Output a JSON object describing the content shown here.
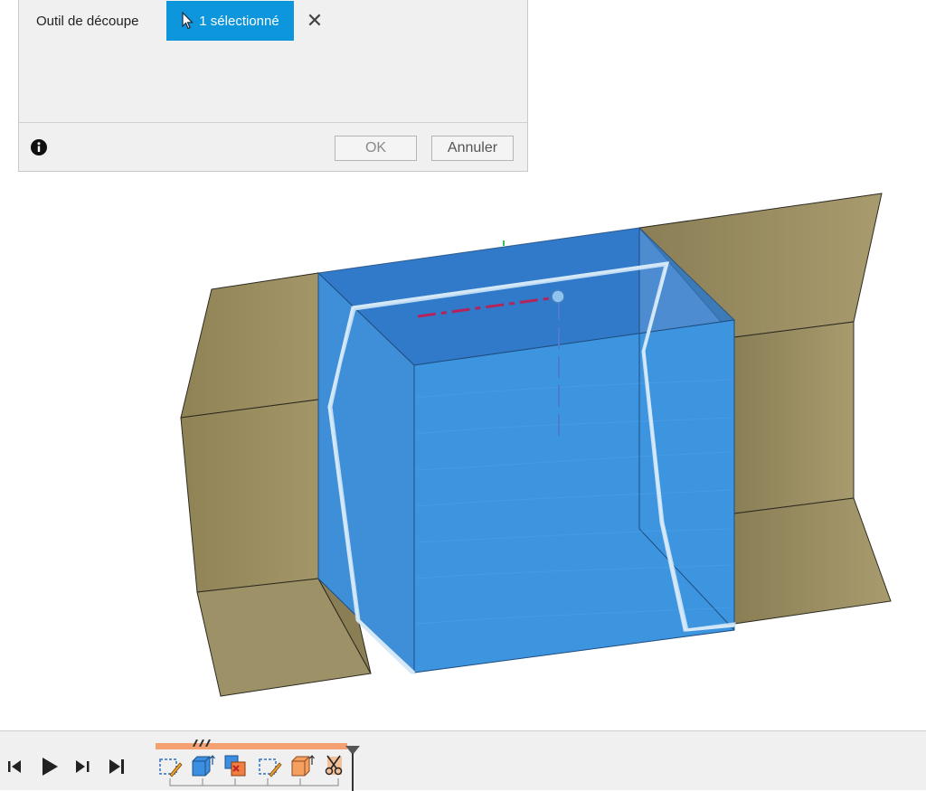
{
  "dialog": {
    "row_label": "Outil de découpe",
    "selection_label": "1 sélectionné",
    "close_symbol": "✕",
    "ok_label": "OK",
    "cancel_label": "Annuler",
    "info_icon": "info-icon",
    "cursor_icon": "cursor-arrow-icon"
  },
  "colors": {
    "accent": "#0d96dc",
    "box_blue": "#3a8fd6",
    "sheet_tan": "#a09468",
    "timeline_track": "#f4a070"
  },
  "timeline": {
    "controls": [
      "step-back-icon",
      "play-icon",
      "step-forward-icon",
      "skip-to-end-icon"
    ],
    "features": [
      "sketch-feature-icon",
      "extrude-feature-icon",
      "combine-feature-icon",
      "sketch-feature-icon",
      "extrude-feature-icon",
      "split-body-feature-icon"
    ]
  }
}
